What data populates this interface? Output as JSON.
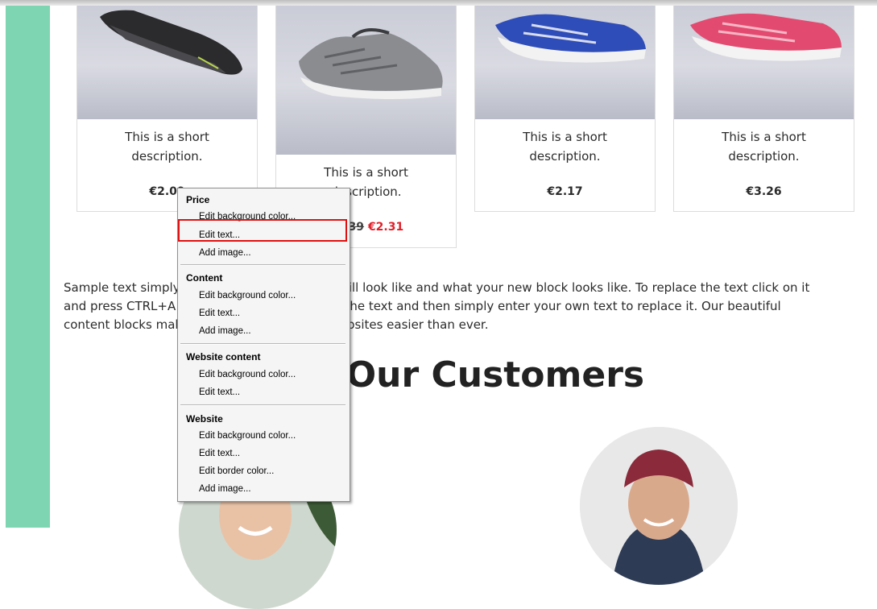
{
  "products": [
    {
      "description": "This is a short description.",
      "price": "€2.09"
    },
    {
      "description": "This is a short description.",
      "old_price": "€2.39",
      "sale_price": "€2.31"
    },
    {
      "description": "This is a short description.",
      "price": "€2.17"
    },
    {
      "description": "This is a short description.",
      "price": "€3.26"
    }
  ],
  "sample_text": "Sample text simply shows you how your text will look like and what your new block looks like. To replace the text click on it and press CTRL+A on your keyboard to select the text and then simply enter your own text to replace it. Our beautiful content blocks make creating great looking websites easier than ever.",
  "customers_heading": "Meet Our Customers",
  "context_menu": {
    "sections": [
      {
        "title": "Price",
        "items": [
          "Edit background color...",
          "Edit text...",
          "Add image..."
        ]
      },
      {
        "title": "Content",
        "items": [
          "Edit background color...",
          "Edit text...",
          "Add image..."
        ]
      },
      {
        "title": "Website content",
        "items": [
          "Edit background color...",
          "Edit text..."
        ]
      },
      {
        "title": "Website",
        "items": [
          "Edit background color...",
          "Edit text...",
          "Edit border color...",
          "Add image..."
        ]
      }
    ],
    "highlighted_item": "Edit text..."
  },
  "colors": {
    "accent_green": "#7dd6b1",
    "sale_red": "#e0202a",
    "highlight_red": "#e01010"
  }
}
